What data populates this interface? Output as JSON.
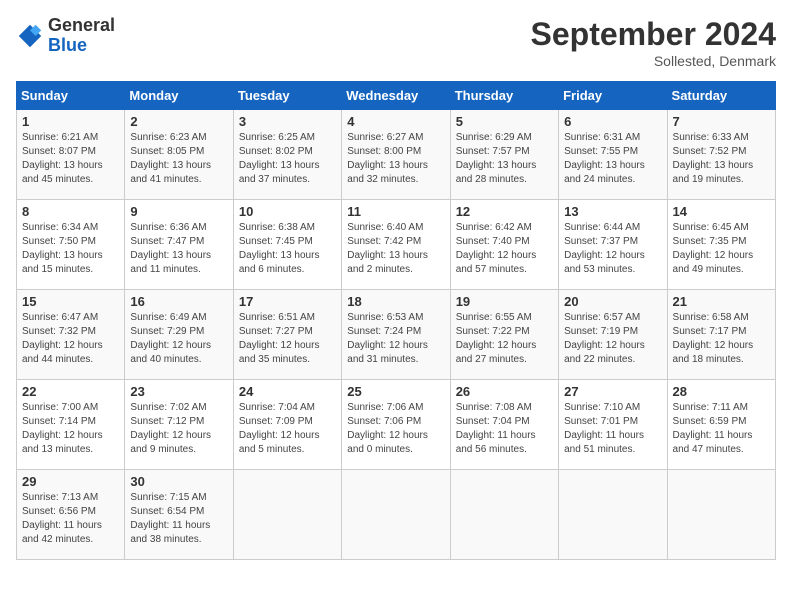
{
  "header": {
    "logo_general": "General",
    "logo_blue": "Blue",
    "month_title": "September 2024",
    "subtitle": "Sollested, Denmark"
  },
  "days_of_week": [
    "Sunday",
    "Monday",
    "Tuesday",
    "Wednesday",
    "Thursday",
    "Friday",
    "Saturday"
  ],
  "weeks": [
    [
      {
        "day": "1",
        "sunrise": "6:21 AM",
        "sunset": "8:07 PM",
        "daylight": "13 hours and 45 minutes."
      },
      {
        "day": "2",
        "sunrise": "6:23 AM",
        "sunset": "8:05 PM",
        "daylight": "13 hours and 41 minutes."
      },
      {
        "day": "3",
        "sunrise": "6:25 AM",
        "sunset": "8:02 PM",
        "daylight": "13 hours and 37 minutes."
      },
      {
        "day": "4",
        "sunrise": "6:27 AM",
        "sunset": "8:00 PM",
        "daylight": "13 hours and 32 minutes."
      },
      {
        "day": "5",
        "sunrise": "6:29 AM",
        "sunset": "7:57 PM",
        "daylight": "13 hours and 28 minutes."
      },
      {
        "day": "6",
        "sunrise": "6:31 AM",
        "sunset": "7:55 PM",
        "daylight": "13 hours and 24 minutes."
      },
      {
        "day": "7",
        "sunrise": "6:33 AM",
        "sunset": "7:52 PM",
        "daylight": "13 hours and 19 minutes."
      }
    ],
    [
      {
        "day": "8",
        "sunrise": "6:34 AM",
        "sunset": "7:50 PM",
        "daylight": "13 hours and 15 minutes."
      },
      {
        "day": "9",
        "sunrise": "6:36 AM",
        "sunset": "7:47 PM",
        "daylight": "13 hours and 11 minutes."
      },
      {
        "day": "10",
        "sunrise": "6:38 AM",
        "sunset": "7:45 PM",
        "daylight": "13 hours and 6 minutes."
      },
      {
        "day": "11",
        "sunrise": "6:40 AM",
        "sunset": "7:42 PM",
        "daylight": "13 hours and 2 minutes."
      },
      {
        "day": "12",
        "sunrise": "6:42 AM",
        "sunset": "7:40 PM",
        "daylight": "12 hours and 57 minutes."
      },
      {
        "day": "13",
        "sunrise": "6:44 AM",
        "sunset": "7:37 PM",
        "daylight": "12 hours and 53 minutes."
      },
      {
        "day": "14",
        "sunrise": "6:45 AM",
        "sunset": "7:35 PM",
        "daylight": "12 hours and 49 minutes."
      }
    ],
    [
      {
        "day": "15",
        "sunrise": "6:47 AM",
        "sunset": "7:32 PM",
        "daylight": "12 hours and 44 minutes."
      },
      {
        "day": "16",
        "sunrise": "6:49 AM",
        "sunset": "7:29 PM",
        "daylight": "12 hours and 40 minutes."
      },
      {
        "day": "17",
        "sunrise": "6:51 AM",
        "sunset": "7:27 PM",
        "daylight": "12 hours and 35 minutes."
      },
      {
        "day": "18",
        "sunrise": "6:53 AM",
        "sunset": "7:24 PM",
        "daylight": "12 hours and 31 minutes."
      },
      {
        "day": "19",
        "sunrise": "6:55 AM",
        "sunset": "7:22 PM",
        "daylight": "12 hours and 27 minutes."
      },
      {
        "day": "20",
        "sunrise": "6:57 AM",
        "sunset": "7:19 PM",
        "daylight": "12 hours and 22 minutes."
      },
      {
        "day": "21",
        "sunrise": "6:58 AM",
        "sunset": "7:17 PM",
        "daylight": "12 hours and 18 minutes."
      }
    ],
    [
      {
        "day": "22",
        "sunrise": "7:00 AM",
        "sunset": "7:14 PM",
        "daylight": "12 hours and 13 minutes."
      },
      {
        "day": "23",
        "sunrise": "7:02 AM",
        "sunset": "7:12 PM",
        "daylight": "12 hours and 9 minutes."
      },
      {
        "day": "24",
        "sunrise": "7:04 AM",
        "sunset": "7:09 PM",
        "daylight": "12 hours and 5 minutes."
      },
      {
        "day": "25",
        "sunrise": "7:06 AM",
        "sunset": "7:06 PM",
        "daylight": "12 hours and 0 minutes."
      },
      {
        "day": "26",
        "sunrise": "7:08 AM",
        "sunset": "7:04 PM",
        "daylight": "11 hours and 56 minutes."
      },
      {
        "day": "27",
        "sunrise": "7:10 AM",
        "sunset": "7:01 PM",
        "daylight": "11 hours and 51 minutes."
      },
      {
        "day": "28",
        "sunrise": "7:11 AM",
        "sunset": "6:59 PM",
        "daylight": "11 hours and 47 minutes."
      }
    ],
    [
      {
        "day": "29",
        "sunrise": "7:13 AM",
        "sunset": "6:56 PM",
        "daylight": "11 hours and 42 minutes."
      },
      {
        "day": "30",
        "sunrise": "7:15 AM",
        "sunset": "6:54 PM",
        "daylight": "11 hours and 38 minutes."
      },
      null,
      null,
      null,
      null,
      null
    ]
  ]
}
